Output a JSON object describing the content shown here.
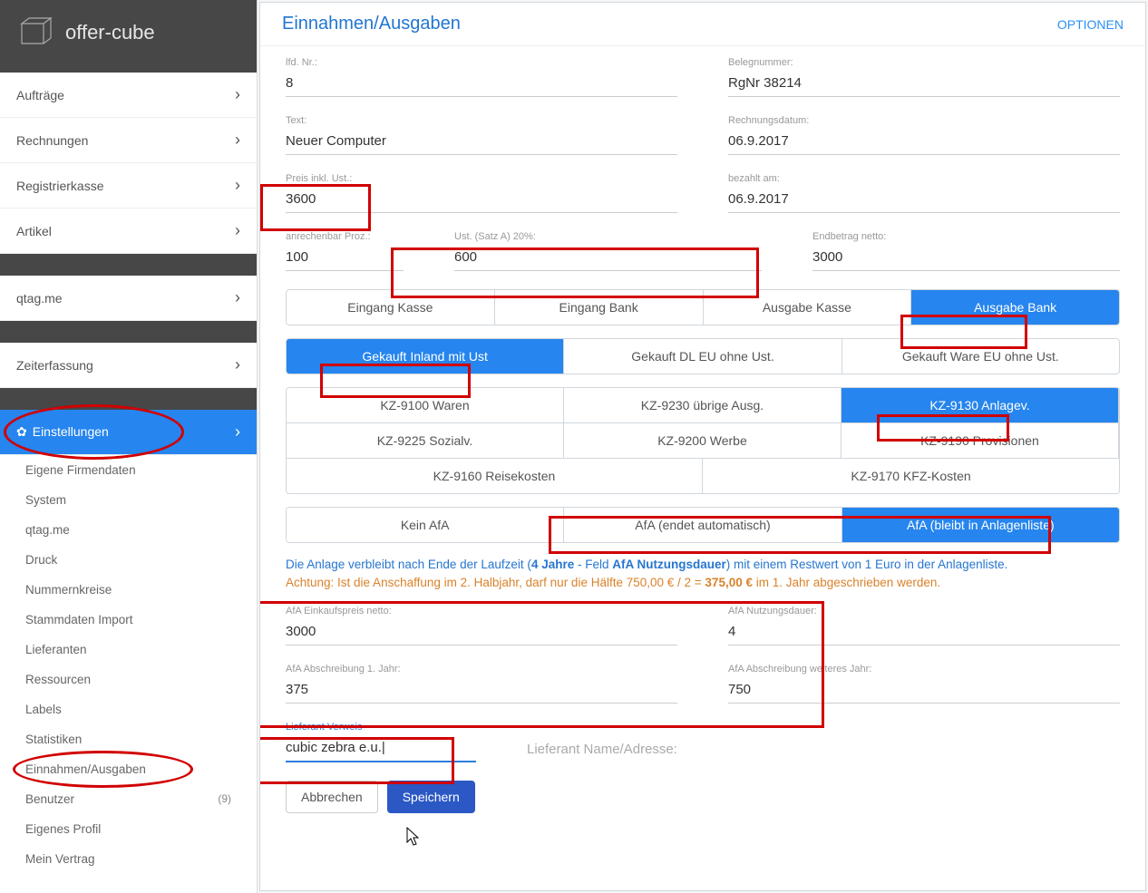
{
  "brand": {
    "name": "offer-cube"
  },
  "header": {
    "title": "Einnahmen/Ausgaben",
    "options": "OPTIONEN"
  },
  "sidebar": {
    "top": [
      {
        "label": "Aufträge"
      },
      {
        "label": "Rechnungen"
      },
      {
        "label": "Registrierkasse"
      },
      {
        "label": "Artikel"
      }
    ],
    "mid1": [
      {
        "label": "qtag.me"
      }
    ],
    "mid2": [
      {
        "label": "Zeiterfassung"
      }
    ],
    "settings": {
      "label": "Einstellungen"
    },
    "subs": [
      {
        "label": "Eigene Firmendaten"
      },
      {
        "label": "System"
      },
      {
        "label": "qtag.me"
      },
      {
        "label": "Druck"
      },
      {
        "label": "Nummernkreise"
      },
      {
        "label": "Stammdaten Import"
      },
      {
        "label": "Lieferanten"
      },
      {
        "label": "Ressourcen"
      },
      {
        "label": "Labels"
      },
      {
        "label": "Statistiken"
      },
      {
        "label": "Einnahmen/Ausgaben"
      },
      {
        "label": "Benutzer",
        "badge": "(9)"
      },
      {
        "label": "Eigenes Profil"
      },
      {
        "label": "Mein Vertrag"
      }
    ]
  },
  "form": {
    "lfd_label": "lfd. Nr.:",
    "lfd_value": "8",
    "beleg_label": "Belegnummer:",
    "beleg_value": "RgNr 38214",
    "text_label": "Text:",
    "text_value": "Neuer Computer",
    "rdat_label": "Rechnungsdatum:",
    "rdat_value": "06.9.2017",
    "preis_label": "Preis inkl. Ust.:",
    "preis_value": "3600",
    "bez_label": "bezahlt am:",
    "bez_value": "06.9.2017",
    "proz_label": "anrechenbar Proz.:",
    "proz_value": "100",
    "ust_label": "Ust. (Satz A) 20%:",
    "ust_value": "600",
    "netto_label": "Endbetrag netto:",
    "netto_value": "3000"
  },
  "btnrow1": [
    {
      "label": "Eingang Kasse"
    },
    {
      "label": "Eingang Bank"
    },
    {
      "label": "Ausgabe Kasse"
    },
    {
      "label": "Ausgabe Bank",
      "active": true
    }
  ],
  "btnrow2": [
    {
      "label": "Gekauft Inland mit Ust",
      "active": true
    },
    {
      "label": "Gekauft DL EU ohne Ust."
    },
    {
      "label": "Gekauft Ware EU ohne Ust."
    }
  ],
  "btnrow3": [
    {
      "label": "KZ-9100 Waren"
    },
    {
      "label": "KZ-9230 übrige Ausg."
    },
    {
      "label": "KZ-9130 Anlagev.",
      "active": true
    },
    {
      "label": "KZ-9225 Sozialv."
    },
    {
      "label": "KZ-9200 Werbe"
    },
    {
      "label": "KZ-9190 Provisionen"
    },
    {
      "label": "KZ-9160 Reisekosten",
      "span": true
    },
    {
      "label": "KZ-9170 KFZ-Kosten",
      "span": true
    }
  ],
  "btnrow4": [
    {
      "label": "Kein AfA"
    },
    {
      "label": "AfA (endet automatisch)"
    },
    {
      "label": "AfA (bleibt in Anlagenliste)",
      "active": true
    }
  ],
  "info": {
    "blue1": "Die Anlage verbleibt nach Ende der Laufzeit (",
    "blue2": "4 Jahre",
    "blue3": " - Feld ",
    "blue4": "AfA Nutzungsdauer",
    "blue5": ") mit einem Restwert von 1 Euro in der Anlagenliste.",
    "orange1": "Achtung: Ist die Anschaffung im 2. Halbjahr, darf nur die Hälfte 750,00 € / 2 = ",
    "orange2": "375,00 €",
    "orange3": " im 1. Jahr abgeschrieben werden."
  },
  "afa": {
    "ek_label": "AfA Einkaufspreis netto:",
    "ek_value": "3000",
    "nd_label": "AfA Nutzungsdauer:",
    "nd_value": "4",
    "a1_label": "AfA Abschreibung 1. Jahr:",
    "a1_value": "375",
    "aw_label": "AfA Abschreibung weiteres Jahr:",
    "aw_value": "750"
  },
  "lief": {
    "verweis_label": "Lieferant Verweis",
    "verweis_value": "cubic zebra e.u.|",
    "name_placeholder": "Lieferant Name/Adresse:"
  },
  "footer": {
    "cancel": "Abbrechen",
    "save": "Speichern"
  }
}
